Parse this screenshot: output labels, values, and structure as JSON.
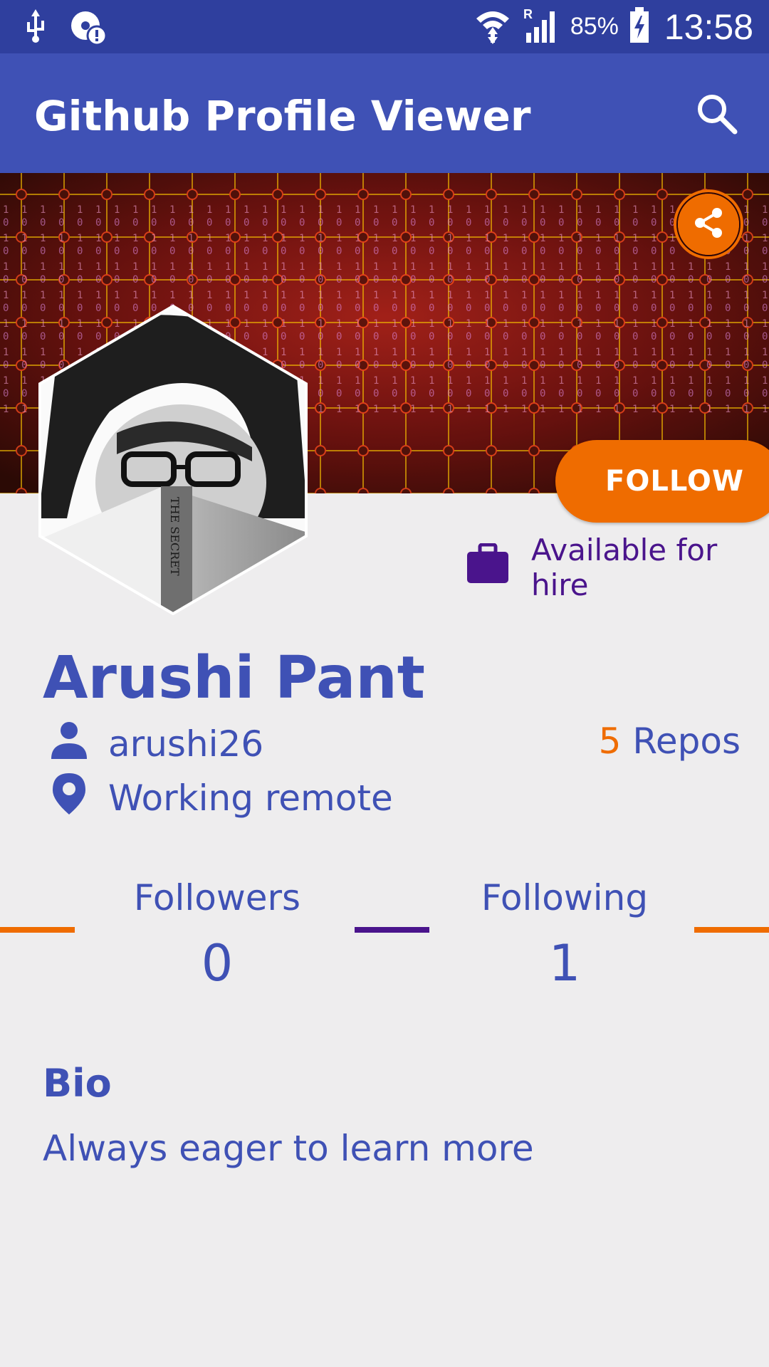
{
  "status_bar": {
    "battery_percent": "85%",
    "time": "13:58",
    "icons": [
      "usb-icon",
      "data-saver-icon",
      "wifi-icon",
      "signal-icon",
      "battery-charging-icon"
    ]
  },
  "app_bar": {
    "title": "Github Profile Viewer",
    "search_icon": "search-icon"
  },
  "profile": {
    "name": "Arushi Pant",
    "username": "arushi26",
    "location": "Working remote",
    "availability": "Available for hire",
    "repos_count": "5",
    "repos_label": "Repos",
    "follow_label": "FOLLOW"
  },
  "stats": {
    "followers_label": "Followers",
    "followers_value": "0",
    "following_label": "Following",
    "following_value": "1"
  },
  "bio": {
    "heading": "Bio",
    "text": "Always eager to learn more"
  },
  "colors": {
    "status_bar": "#2f3f9e",
    "primary": "#3f51b5",
    "accent": "#ef6c00",
    "purple": "#4a148c",
    "background": "#eeedee"
  }
}
